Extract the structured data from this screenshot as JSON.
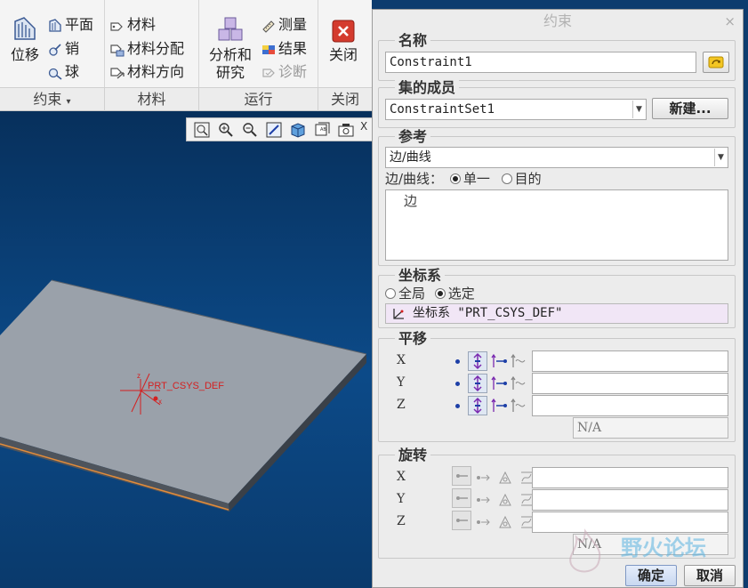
{
  "ribbon": {
    "displace_label": "位移",
    "plane_label": "平面",
    "pin_label": "销",
    "ball_label": "球",
    "material_label": "材料",
    "material_assign_label": "材料分配",
    "material_direction_label": "材料方向",
    "analysis_label_line1": "分析和",
    "analysis_label_line2": "研究",
    "measure_label": "测量",
    "results_label": "结果",
    "diagnose_label": "诊断",
    "close_label": "关闭",
    "groups": {
      "constraints": "约束",
      "material": "材料",
      "run": "运行",
      "close": "关闭"
    },
    "dropdown_marker": "▾"
  },
  "viewport": {
    "csys_label": "PRT_CSYS_DEF",
    "axis_z": "z",
    "axis_x": "x",
    "overflow_marker": "X"
  },
  "dialog": {
    "title": "约束",
    "close_glyph": "×",
    "name": {
      "title": "名称",
      "value": "Constraint1"
    },
    "set_members": {
      "title": "集的成员",
      "value": "ConstraintSet1",
      "new_button": "新建..."
    },
    "references": {
      "title": "参考",
      "type_value": "边/曲线",
      "mode_label": "边/曲线：",
      "option_single": "单一",
      "option_target": "目的",
      "list_item": "边"
    },
    "csys": {
      "title": "坐标系",
      "option_global": "全局",
      "option_selected": "选定",
      "selected_text": "坐标系 \"PRT_CSYS_DEF\""
    },
    "translation": {
      "title": "平移",
      "axes": [
        "X",
        "Y",
        "Z"
      ],
      "na": "N/A"
    },
    "rotation": {
      "title": "旋转",
      "axes": [
        "X",
        "Y",
        "Z"
      ],
      "na": "N/A"
    },
    "ok_button": "确定",
    "cancel_button": "取消"
  },
  "colors": {
    "accent_red": "#d43b2e",
    "viewport_bg": "#0c4a88",
    "model_face": "#9aa1aa",
    "selection_highlight": "#f1e6f6"
  },
  "watermark_text": "野火论坛"
}
